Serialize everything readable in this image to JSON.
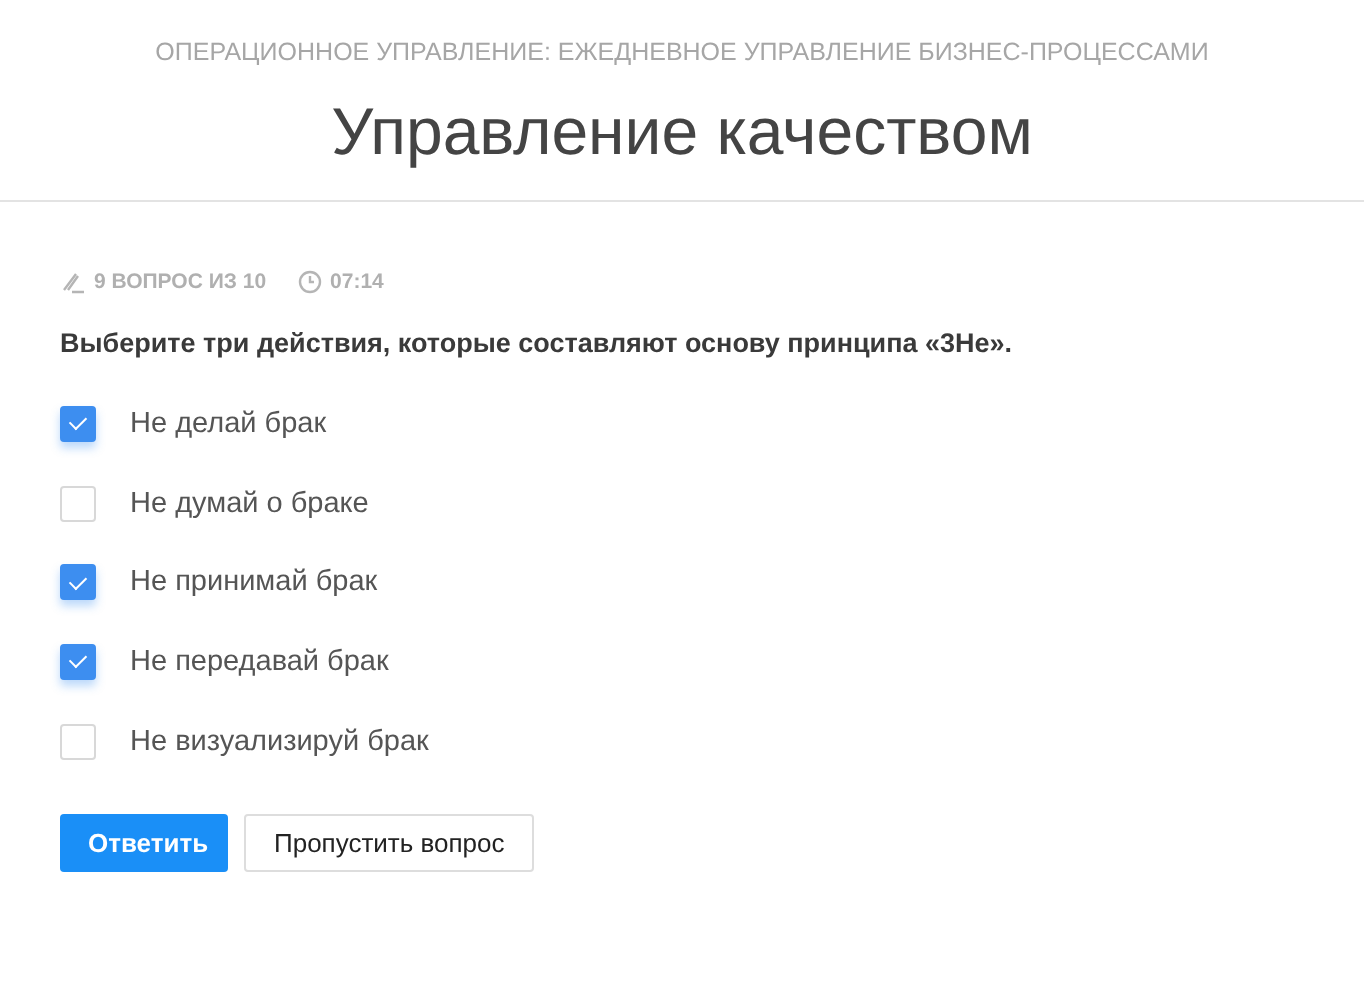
{
  "course": "ОПЕРАЦИОННОЕ УПРАВЛЕНИЕ: ЕЖЕДНЕВНОЕ УПРАВЛЕНИЕ БИЗНЕС-ПРОЦЕССАМИ",
  "title": "Управление качеством",
  "progress": "9 ВОПРОС ИЗ 10",
  "timer": "07:14",
  "question": "Выберите три действия, которые составляют основу принципа «3Не».",
  "options": [
    {
      "label": "Не делай брак",
      "checked": true
    },
    {
      "label": "Не думай о браке",
      "checked": false
    },
    {
      "label": "Не принимай брак",
      "checked": true
    },
    {
      "label": "Не передавай брак",
      "checked": true
    },
    {
      "label": "Не визуализируй брак",
      "checked": false
    }
  ],
  "buttons": [
    {
      "label": "Ответить",
      "kind": "primary"
    },
    {
      "label": "Пропустить вопрос",
      "kind": "secondary"
    }
  ]
}
